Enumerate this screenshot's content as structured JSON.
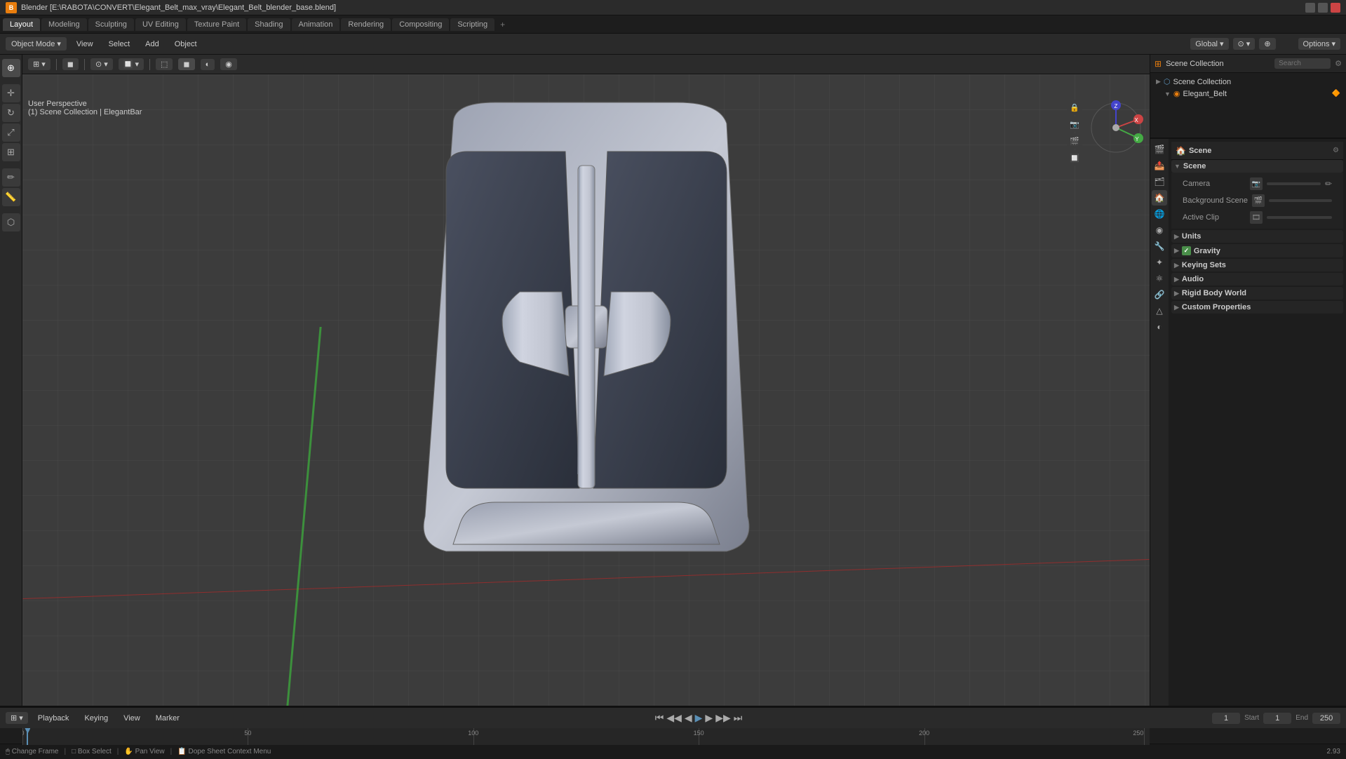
{
  "titleBar": {
    "title": "Blender [E:\\RABOTA\\CONVERT\\Elegant_Belt_max_vray\\Elegant_Belt_blender_base.blend]",
    "appIcon": "B"
  },
  "workspaceTabs": {
    "tabs": [
      {
        "label": "Layout",
        "active": true
      },
      {
        "label": "Modeling",
        "active": false
      },
      {
        "label": "Sculpting",
        "active": false
      },
      {
        "label": "UV Editing",
        "active": false
      },
      {
        "label": "Texture Paint",
        "active": false
      },
      {
        "label": "Shading",
        "active": false
      },
      {
        "label": "Animation",
        "active": false
      },
      {
        "label": "Rendering",
        "active": false
      },
      {
        "label": "Compositing",
        "active": false
      },
      {
        "label": "Scripting",
        "active": false
      }
    ],
    "plus": "+"
  },
  "header": {
    "modeLabel": "Object Mode",
    "viewLabel": "View",
    "selectLabel": "Select",
    "addLabel": "Add",
    "objectLabel": "Object",
    "transformOrient": "Global",
    "snap": "⊙",
    "optionsLabel": "Options"
  },
  "viewport": {
    "info1": "User Perspective",
    "info2": "(1) Scene Collection | ElegantBar",
    "overlayButtons": [
      "💡",
      "🎭",
      "🔲",
      "◉",
      "🌐",
      "📐"
    ]
  },
  "outliner": {
    "title": "Scene Collection",
    "searchPlaceholder": "Search",
    "items": [
      {
        "label": "Elegant_Belt",
        "icon": "▶",
        "hasChildren": true
      }
    ]
  },
  "propertiesPanel": {
    "activeTab": "scene",
    "tabs": [
      "render",
      "output",
      "viewLayer",
      "scene",
      "world",
      "object",
      "modifier",
      "particles",
      "physics",
      "constraints",
      "data",
      "material"
    ],
    "scene": {
      "title": "Scene",
      "sections": {
        "scene": {
          "label": "Scene",
          "expanded": true,
          "camera": {
            "label": "Camera",
            "value": "",
            "icon": "📷"
          },
          "backgroundScene": {
            "label": "Background Scene",
            "value": "",
            "icon": "🎬"
          },
          "activeClip": {
            "label": "Active Clip",
            "value": "",
            "icon": "🎞️"
          }
        },
        "units": {
          "label": "Units",
          "expanded": false
        },
        "gravity": {
          "label": "Gravity",
          "expanded": false,
          "enabled": true
        },
        "keyingSets": {
          "label": "Keying Sets",
          "expanded": false
        },
        "audio": {
          "label": "Audio",
          "expanded": false
        },
        "rigidBodyWorld": {
          "label": "Rigid Body World",
          "expanded": false
        },
        "customProperties": {
          "label": "Custom Properties",
          "expanded": false
        }
      }
    }
  },
  "timeline": {
    "playback": "Playback",
    "keying": "Keying",
    "view": "View",
    "marker": "Marker",
    "currentFrame": "1",
    "startFrame": "1",
    "endFrame": "250",
    "ticks": [
      0,
      50,
      100,
      150,
      200,
      250
    ],
    "labels": [
      "0",
      "50",
      "100",
      "150",
      "200",
      "250"
    ]
  },
  "statusBar": {
    "items": [
      {
        "icon": "🖱️",
        "text": "Change Frame"
      },
      {
        "icon": "□",
        "text": "Box Select"
      },
      {
        "icon": "✋",
        "text": "Pan View"
      },
      {
        "icon": "📋",
        "text": "Dope Sheet Context Menu"
      }
    ],
    "version": "2.93"
  },
  "icons": {
    "cursor": "⊕",
    "move": "✛",
    "rotate": "↻",
    "scale": "⤢",
    "transform": "⊞",
    "annotate": "✏️",
    "measure": "📏",
    "addPrimitive": "⬡"
  }
}
